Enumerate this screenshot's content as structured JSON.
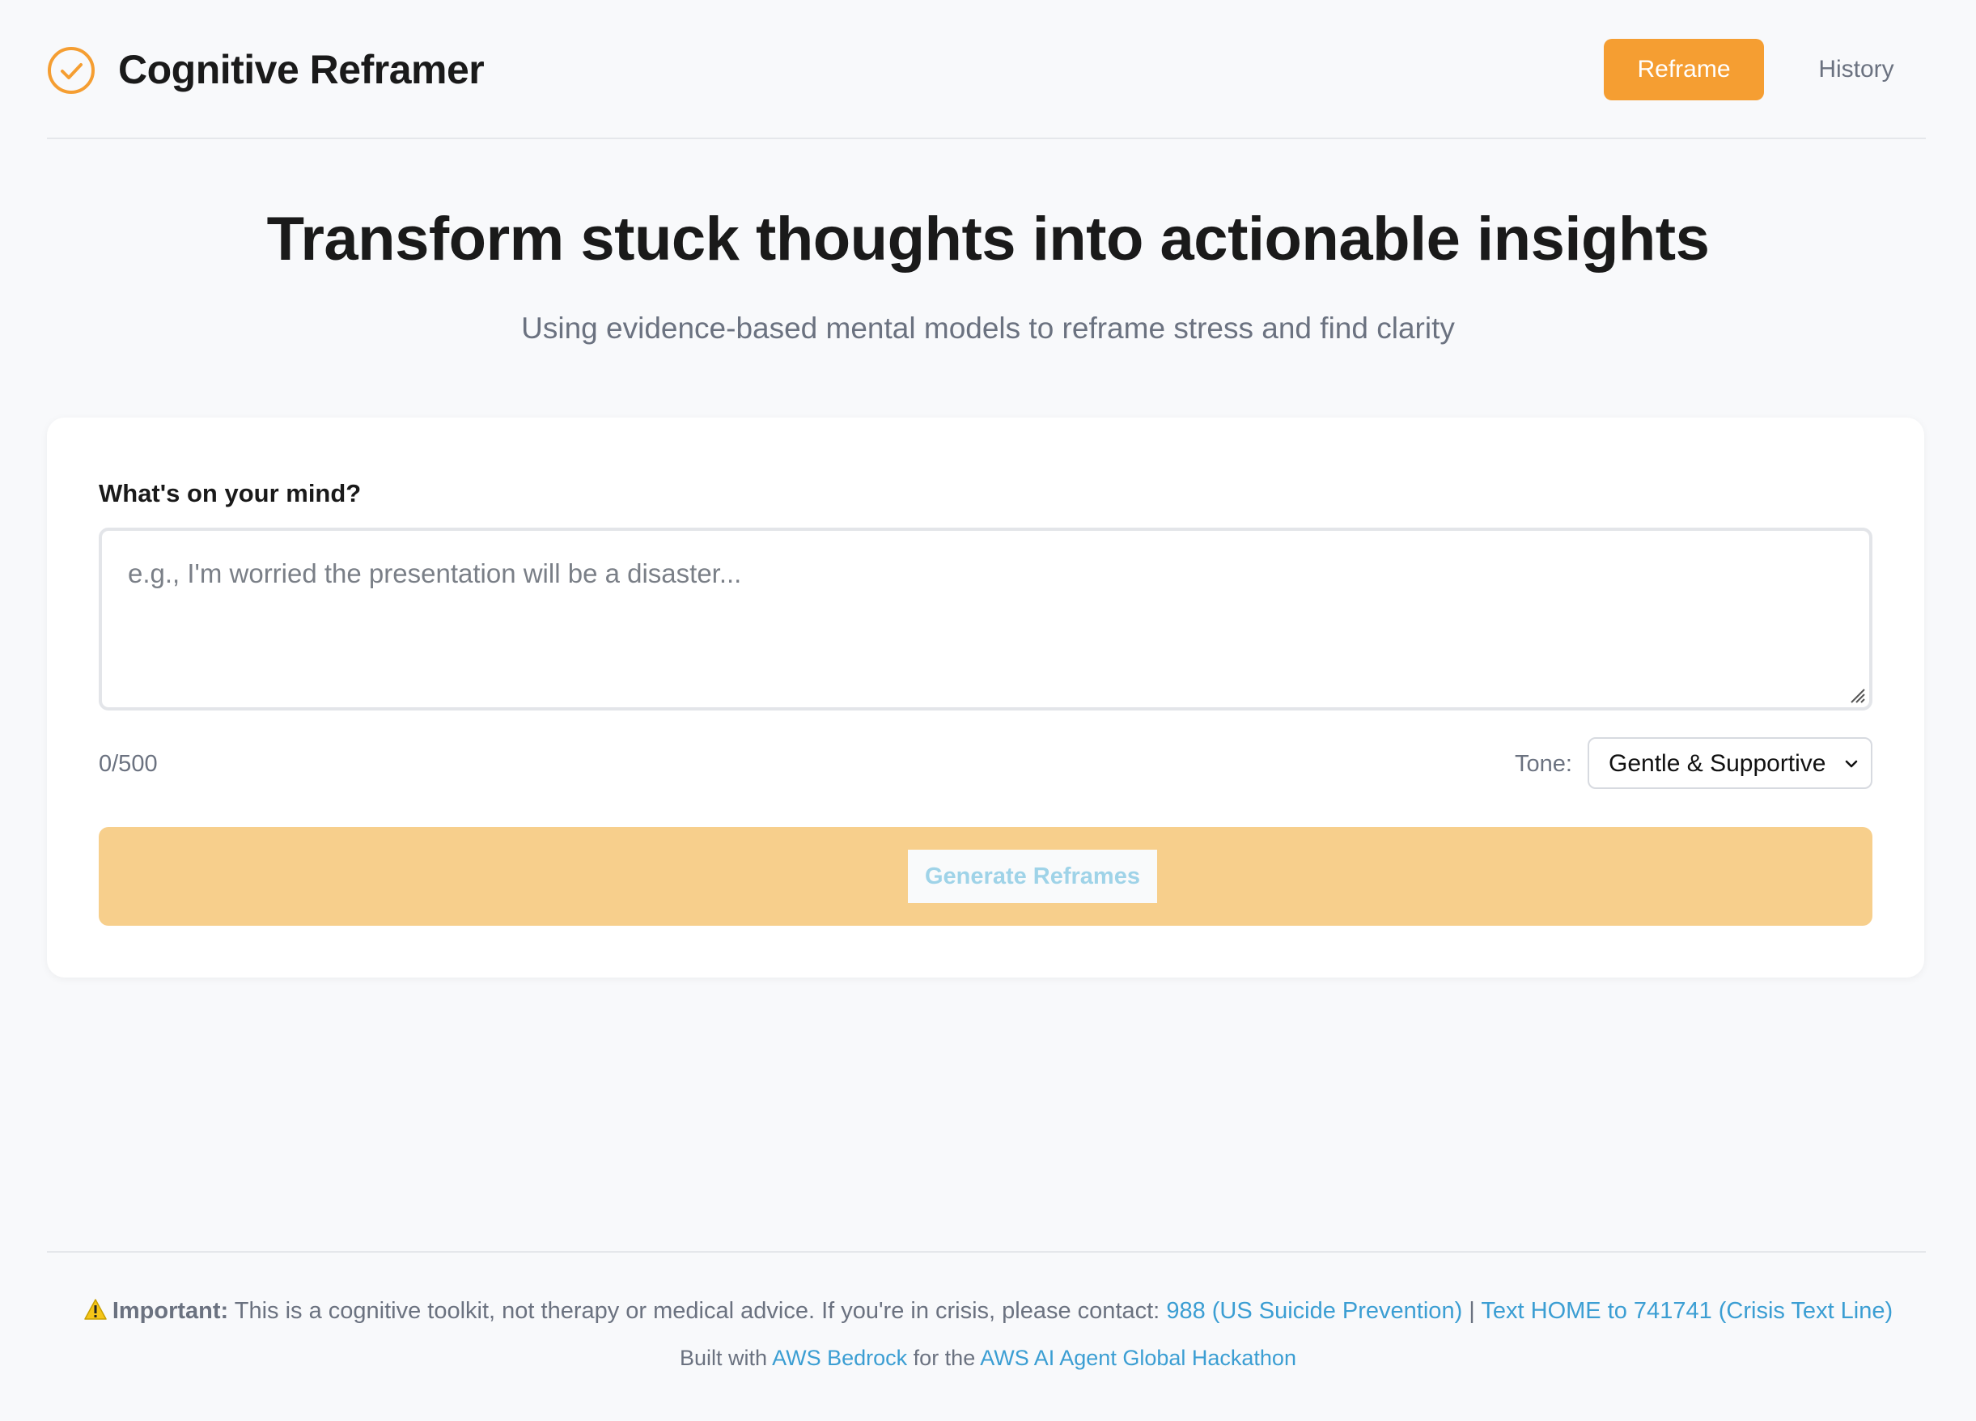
{
  "header": {
    "app_title": "Cognitive Reframer",
    "logo_icon": "check-circle-icon",
    "nav": {
      "reframe_label": "Reframe",
      "history_label": "History"
    }
  },
  "hero": {
    "title": "Transform stuck thoughts into actionable insights",
    "subtitle": "Using evidence-based mental models to reframe stress and find clarity"
  },
  "form": {
    "label": "What's on your mind?",
    "placeholder": "e.g., I'm worried the presentation will be a disaster...",
    "value": "",
    "char_count": "0/500",
    "tone_label": "Tone:",
    "tone_selected": "Gentle & Supportive",
    "generate_label": "Generate Reframes"
  },
  "footer": {
    "warning_icon": "warning-icon",
    "important_label": "Important:",
    "disclaimer_text": "This is a cognitive toolkit, not therapy or medical advice. If you're in crisis, please contact:",
    "link_988": "988 (US Suicide Prevention)",
    "separator": "|",
    "link_crisis_text": "Text HOME to 741741 (Crisis Text Line)",
    "built_with": "Built with",
    "link_bedrock": "AWS Bedrock",
    "for_the": "for the",
    "link_hackathon": "AWS AI Agent Global Hackathon"
  },
  "colors": {
    "accent": "#f59e32",
    "generate_bar": "#f7cf8c",
    "link": "#3b9ed3",
    "muted_text": "#6b7280",
    "background": "#f8f9fb"
  }
}
